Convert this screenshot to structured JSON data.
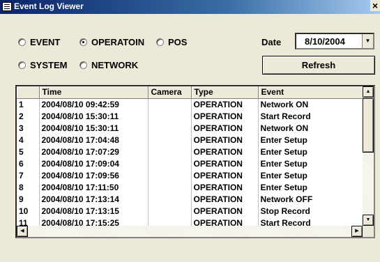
{
  "window": {
    "title": "Event Log Viewer",
    "close_glyph": "×"
  },
  "filters": {
    "options": [
      {
        "label": "EVENT",
        "selected": false
      },
      {
        "label": "OPERATOIN",
        "selected": true
      },
      {
        "label": "POS",
        "selected": false
      },
      {
        "label": "SYSTEM",
        "selected": false
      },
      {
        "label": "NETWORK",
        "selected": false
      }
    ]
  },
  "date": {
    "label": "Date",
    "value": "8/10/2004",
    "arrow": "▼"
  },
  "refresh_label": "Refresh",
  "table": {
    "columns": [
      "",
      "Time",
      "Camera",
      "Type",
      "Event"
    ],
    "rows": [
      [
        "1",
        "2004/08/10 09:42:59",
        "",
        "OPERATION",
        "Network ON"
      ],
      [
        "2",
        "2004/08/10 15:30:11",
        "",
        "OPERATION",
        "Start Record"
      ],
      [
        "3",
        "2004/08/10 15:30:11",
        "",
        "OPERATION",
        "Network ON"
      ],
      [
        "4",
        "2004/08/10 17:04:48",
        "",
        "OPERATION",
        "Enter Setup"
      ],
      [
        "5",
        "2004/08/10 17:07:29",
        "",
        "OPERATION",
        "Enter Setup"
      ],
      [
        "6",
        "2004/08/10 17:09:04",
        "",
        "OPERATION",
        "Enter Setup"
      ],
      [
        "7",
        "2004/08/10 17:09:56",
        "",
        "OPERATION",
        "Enter Setup"
      ],
      [
        "8",
        "2004/08/10 17:11:50",
        "",
        "OPERATION",
        "Enter Setup"
      ],
      [
        "9",
        "2004/08/10 17:13:14",
        "",
        "OPERATION",
        "Network OFF"
      ],
      [
        "10",
        "2004/08/10 17:13:15",
        "",
        "OPERATION",
        "Stop Record"
      ],
      [
        "11",
        "2004/08/10 17:15:25",
        "",
        "OPERATION",
        "Start Record"
      ]
    ]
  },
  "scroll": {
    "up": "▲",
    "down": "▼",
    "left": "◀",
    "right": "▶"
  }
}
